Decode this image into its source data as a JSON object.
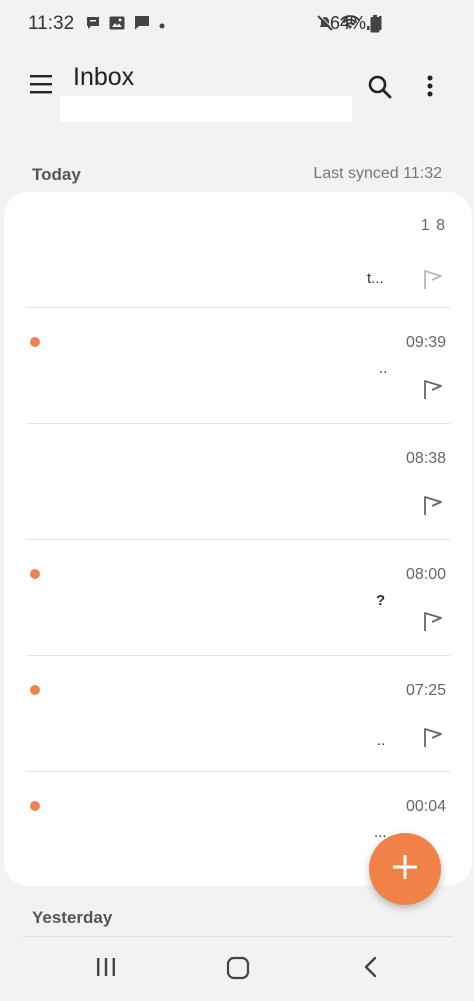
{
  "status_bar": {
    "time": "11:32",
    "battery": "64%",
    "left_icons": [
      "chat-notification-icon",
      "image-icon",
      "message-icon",
      "dot-icon"
    ],
    "right_icons": [
      "mute-icon",
      "wifi-icon",
      "signal-icon",
      "battery-icon"
    ]
  },
  "app_bar": {
    "title": "Inbox",
    "account": ""
  },
  "sections": {
    "today": "Today",
    "last_synced": "Last synced  11:32",
    "yesterday": "Yesterday"
  },
  "emails": [
    {
      "time": "1    8",
      "unread": false,
      "snippet": "t..."
    },
    {
      "time": "09:39",
      "unread": true,
      "snippet": ".."
    },
    {
      "time": "08:38",
      "unread": false,
      "snippet": ""
    },
    {
      "time": "08:00",
      "unread": true,
      "snippet": "?"
    },
    {
      "time": "07:25",
      "unread": true,
      "snippet": ".."
    },
    {
      "time": "00:04",
      "unread": true,
      "snippet": "..."
    }
  ],
  "colors": {
    "accent": "#f08247",
    "unread_dot": "#ee8350",
    "background": "#f2f2f2",
    "card": "#ffffff"
  },
  "fab": {
    "icon": "plus-icon"
  },
  "nav_bar": {
    "icons": [
      "recent-apps-icon",
      "home-icon",
      "back-icon"
    ]
  }
}
